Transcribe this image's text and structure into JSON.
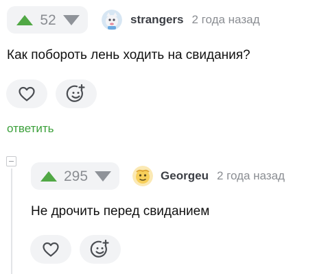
{
  "comment": {
    "score": "52",
    "author": "strangers",
    "time": "2 года назад",
    "text": "Как побороть лень ходить на свидания?",
    "reply_label": "ответить"
  },
  "reply": {
    "score": "295",
    "author": "Georgeu",
    "time": "2 года назад",
    "text": "Не дрочить перед свиданием"
  },
  "icons": {
    "upvote": "arrow-up",
    "downvote": "arrow-down",
    "like": "heart",
    "react": "smiley-plus",
    "collapse": "minus-square"
  },
  "colors": {
    "upvote": "#51a845",
    "downvote": "#8f9399",
    "reply_link": "#3ba03a",
    "button_bg": "#f2f3f5"
  }
}
